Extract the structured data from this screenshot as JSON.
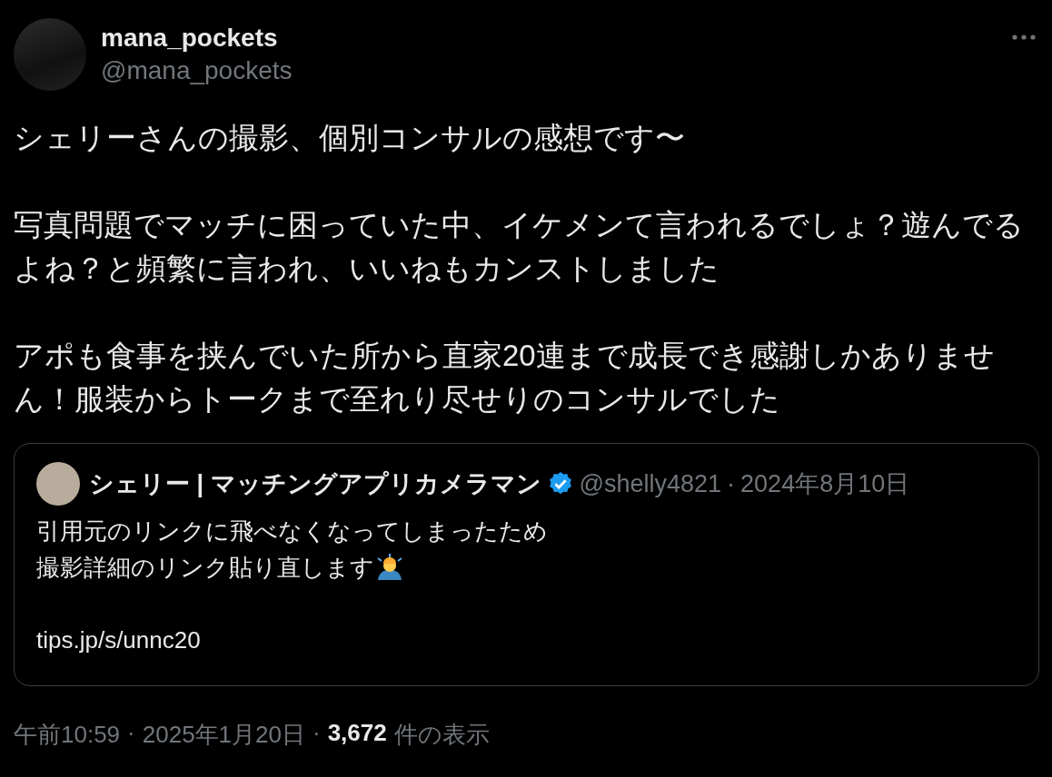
{
  "author": {
    "name": "mana_pockets",
    "handle": "@mana_pockets"
  },
  "body": [
    [
      "シェリーさんの撮影、個別コンサルの感想です〜"
    ],
    [
      "写真問題でマッチに困っていた中、イケメンて言われるでしょ？遊んでる",
      "よね？と頻繁に言われ、いいねもカンストしました"
    ],
    [
      "アポも食事を挟んでいた所から直家20連まで成長でき感謝しかありませ",
      "ん！服装からトークまで至れり尽せりのコンサルでした"
    ]
  ],
  "quote": {
    "name": "シェリー | マッチングアプリカメラマン",
    "verified": true,
    "handle": "@shelly4821",
    "separator": "·",
    "date": "2024年8月10日",
    "lines": [
      "引用元のリンクに飛べなくなってしまったため",
      "撮影詳細のリンク貼り直します"
    ],
    "link": "tips.jp/s/unnc20"
  },
  "footer": {
    "time": "午前10:59",
    "separators": [
      "·",
      "·"
    ],
    "date": "2025年1月20日",
    "views": "3,672",
    "views_label": "件の表示"
  }
}
